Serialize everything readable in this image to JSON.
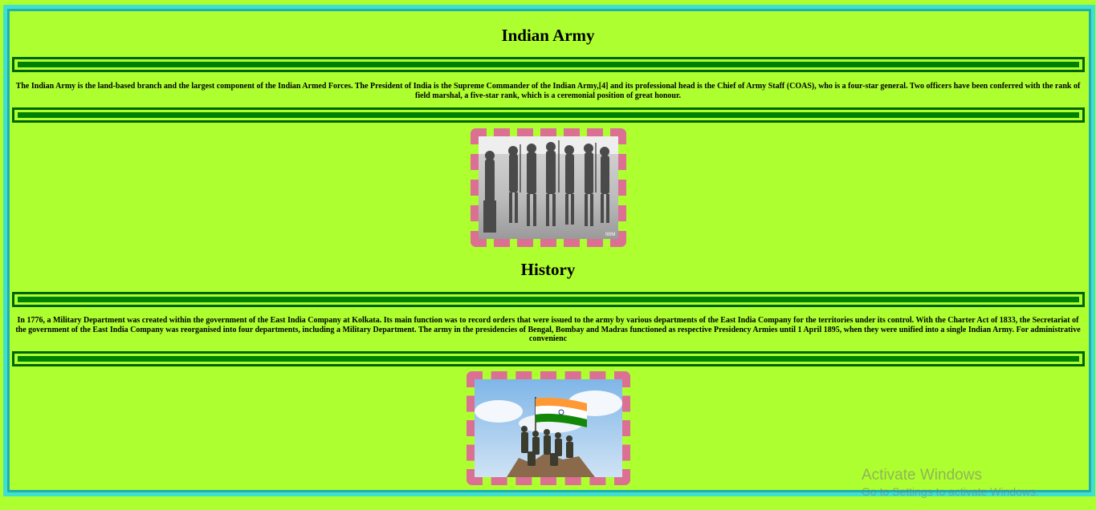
{
  "page": {
    "title": "Indian Army",
    "intro": "The Indian Army is the land-based branch and the largest component of the Indian Armed Forces. The President of India is the Supreme Commander of the Indian Army,[4] and its professional head is the Chief of Army Staff (COAS), who is a four-star general. Two officers have been conferred with the rank of field marshal, a five-star rank, which is a ceremonial position of great honour.",
    "history_heading": "History",
    "history_text": "In 1776, a Military Department was created within the government of the East India Company at Kolkata. Its main function was to record orders that were issued to the army by various departments of the East India Company for the territories under its control. With the Charter Act of 1833, the Secretariat of the government of the East India Company was reorganised into four departments, including a Military Department. The army in the presidencies of Bengal, Bombay and Madras functioned as respective Presidency Armies until 1 April 1895, when they were unified into a single Indian Army. For administrative convenienc"
  },
  "images": {
    "photo1_desc": "historic-soldiers-photo",
    "photo1_credit": "IWM",
    "photo2_desc": "soldiers-with-flag-photo"
  },
  "watermark": {
    "title": "Activate Windows",
    "subtitle": "Go to Settings to activate Windows."
  },
  "colors": {
    "background": "#adff2f",
    "outer_border": "#40e0d0",
    "inner_border": "#20b2aa",
    "rule": "#006400",
    "image_border": "#db7093"
  }
}
